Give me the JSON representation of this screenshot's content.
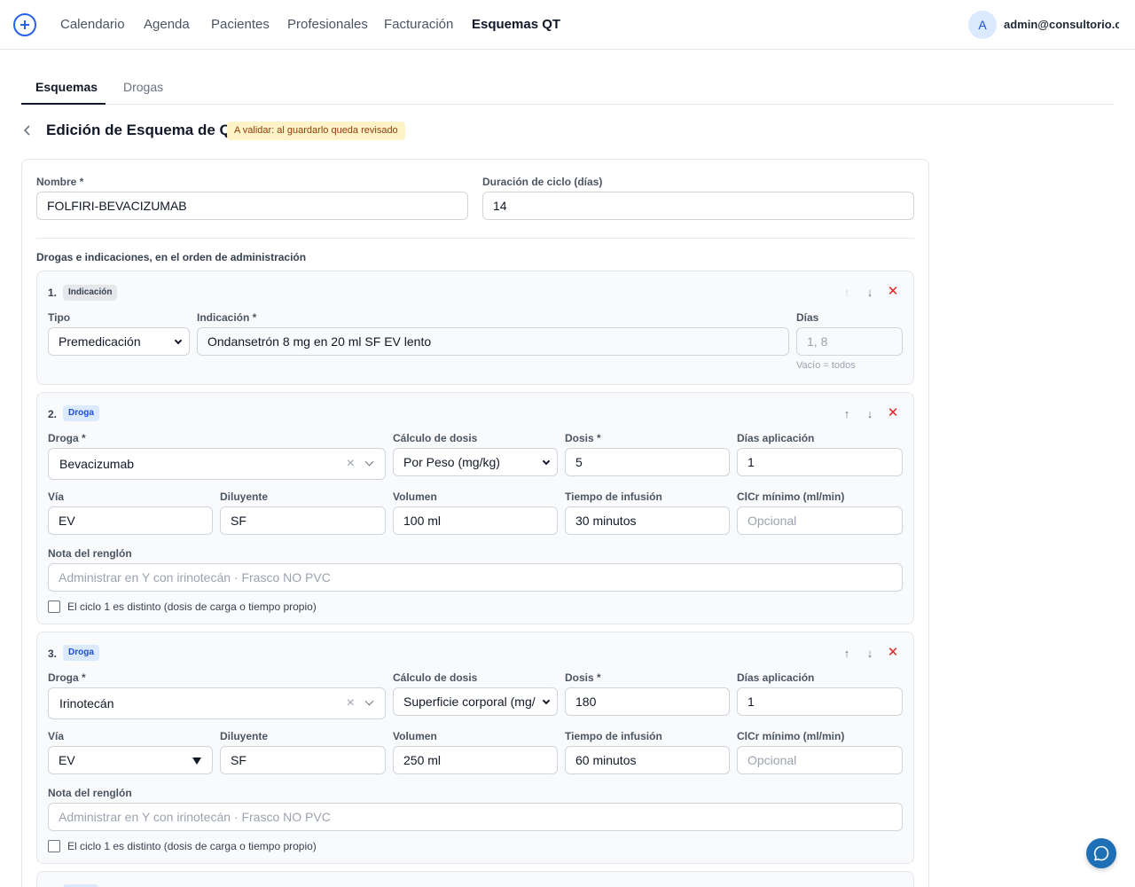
{
  "nav": {
    "items": [
      "Calendario",
      "Agenda",
      "Pacientes",
      "Profesionales",
      "Facturación",
      "Esquemas QT"
    ],
    "active": "Esquemas QT",
    "avatar_initial": "A",
    "user_email": "admin@consultorio.c..."
  },
  "tabs": [
    "Esquemas",
    "Drogas"
  ],
  "page": {
    "title": "Edición de Esquema de QT",
    "badge": "A validar: al guardarlo queda revisado"
  },
  "form": {
    "name_label": "Nombre *",
    "name_value": "FOLFIRI-BEVACIZUMAB",
    "cycle_label": "Duración de ciclo (días)",
    "cycle_value": "14",
    "section_label": "Drogas e indicaciones, en el orden de administración"
  },
  "rows": [
    {
      "num": "1.",
      "tag": "Indicación",
      "tipo_label": "Tipo",
      "tipo_value": "Premedicación",
      "indicacion_label": "Indicación *",
      "indicacion_value": "Ondansetrón 8 mg en 20 ml SF EV lento",
      "dias_label": "Días",
      "dias_placeholder": "1, 8",
      "dias_hint": "Vacío = todos"
    },
    {
      "num": "2.",
      "tag": "Droga",
      "droga_label": "Droga *",
      "droga_value": "Bevacizumab",
      "calculo_label": "Cálculo de dosis",
      "calculo_value": "Por Peso (mg/kg)",
      "dosis_label": "Dosis *",
      "dosis_value": "5",
      "dias_label": "Días aplicación",
      "dias_value": "1",
      "via_label": "Vía",
      "via_value": "EV",
      "diluyente_label": "Diluyente",
      "diluyente_value": "SF",
      "volumen_label": "Volumen",
      "volumen_value": "100 ml",
      "tiempo_label": "Tiempo de infusión",
      "tiempo_value": "30 minutos",
      "clcr_label": "ClCr mínimo (ml/min)",
      "clcr_placeholder": "Opcional",
      "nota_label": "Nota del renglón",
      "nota_placeholder": "Administrar en Y con irinotecán · Frasco NO PVC",
      "checkbox_label": "El ciclo 1 es distinto (dosis de carga o tiempo propio)"
    },
    {
      "num": "3.",
      "tag": "Droga",
      "droga_label": "Droga *",
      "droga_value": "Irinotecán",
      "calculo_label": "Cálculo de dosis",
      "calculo_value": "Superficie corporal (mg/",
      "dosis_label": "Dosis *",
      "dosis_value": "180",
      "dias_label": "Días aplicación",
      "dias_value": "1",
      "via_label": "Vía",
      "via_value": "EV",
      "diluyente_label": "Diluyente",
      "diluyente_value": "SF",
      "volumen_label": "Volumen",
      "volumen_value": "250 ml",
      "tiempo_label": "Tiempo de infusión",
      "tiempo_value": "60 minutos",
      "clcr_label": "ClCr mínimo (ml/min)",
      "clcr_placeholder": "Opcional",
      "nota_label": "Nota del renglón",
      "nota_placeholder": "Administrar en Y con irinotecán · Frasco NO PVC",
      "checkbox_label": "El ciclo 1 es distinto (dosis de carga o tiempo propio)"
    }
  ],
  "icons": {
    "logo": "plus-circle-icon",
    "back": "chevron-left-icon",
    "move_up": "arrow-up-icon",
    "move_down": "arrow-down-icon",
    "remove": "close-icon",
    "chat": "chat-bubble-icon"
  },
  "colors": {
    "accent": "#2563eb",
    "badge_bg": "#fef3c7",
    "badge_text": "#92400e",
    "remove": "#dc2626",
    "pill_blue_bg": "#dbeafe",
    "chat_fab": "#1e6fb6"
  }
}
